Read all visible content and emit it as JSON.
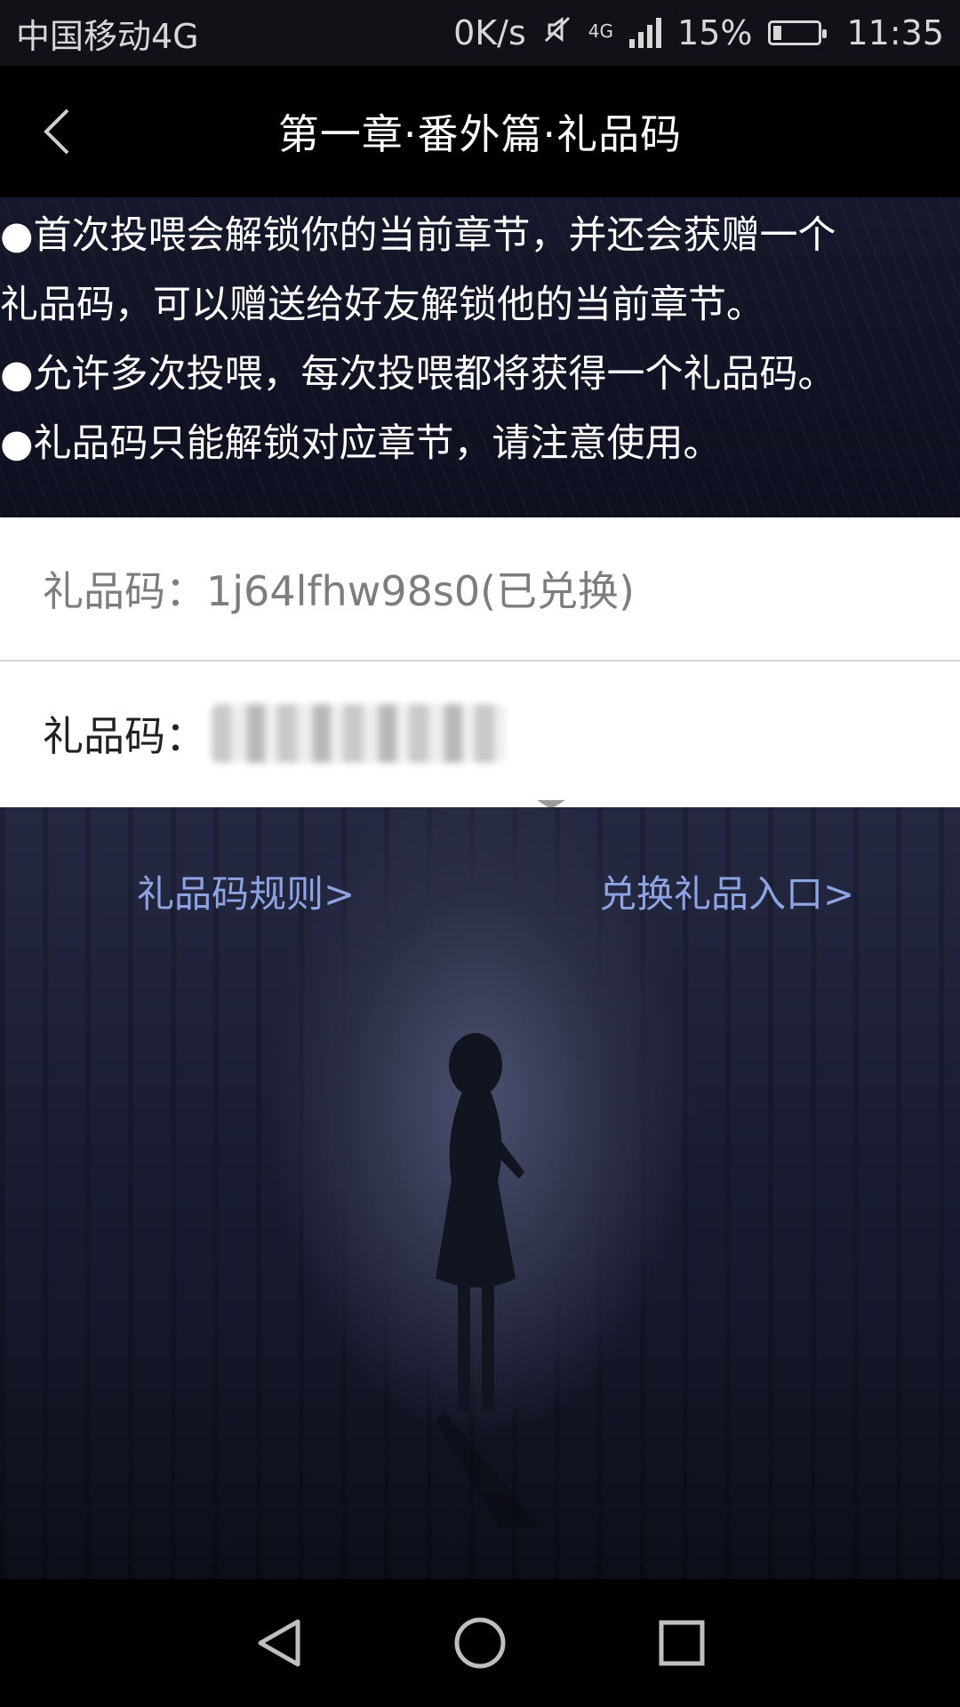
{
  "status_bar": {
    "carrier": "中国移动4G",
    "net_speed": "0K/s",
    "network": "4G",
    "battery": "15%",
    "time": "11:35"
  },
  "header": {
    "title": "第一章·番外篇·礼品码"
  },
  "notice": {
    "lines": [
      "●首次投喂会解锁你的当前章节，并还会获赠一个",
      "礼品码，可以赠送给好友解锁他的当前章节。",
      "●允许多次投喂，每次投喂都将获得一个礼品码。",
      "●礼品码只能解锁对应章节，请注意使用。"
    ]
  },
  "codes": {
    "redeemed_label": "礼品码：",
    "redeemed_value": "1j64lfhw98s0(已兑换)",
    "active_label": "礼品码："
  },
  "links": {
    "rules": "礼品码规则>",
    "redeem": "兑换礼品入口>"
  },
  "colors": {
    "link": "#8ea4e2",
    "header_bg": "#000000"
  }
}
